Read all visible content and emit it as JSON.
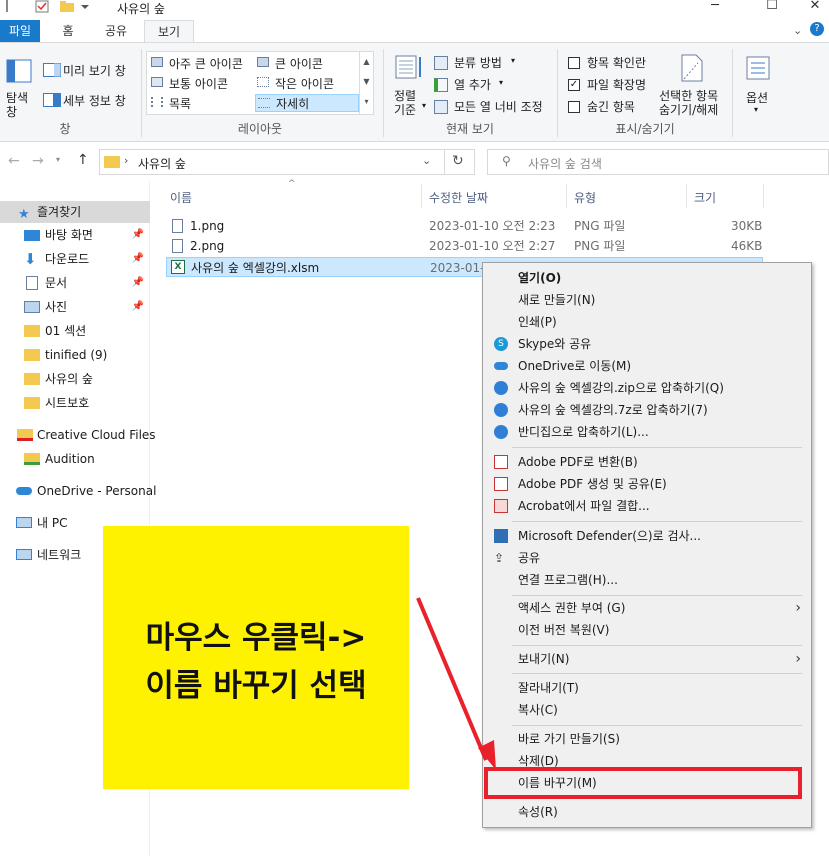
{
  "window": {
    "title": "사유의 숲",
    "minimize": "─",
    "maximize": "☐",
    "close": "✕"
  },
  "tabs": [
    "파일",
    "홈",
    "공유",
    "보기"
  ],
  "ribbon": {
    "pane": {
      "nav_pane": "탐색\n창",
      "preview": "미리 보기 창",
      "details": "세부 정보 창",
      "group": "창"
    },
    "layout": {
      "items": [
        "아주 큰 아이콘",
        "큰 아이콘",
        "보통 아이콘",
        "작은 아이콘",
        "목록",
        "자세히"
      ],
      "group": "레이아웃"
    },
    "current_view": {
      "sort": "정렬\n기준",
      "group_by": "분류 방법",
      "add_column": "열 추가",
      "fit_columns": "모든 열 너비 조정",
      "group": "현재 보기"
    },
    "show_hide": {
      "item_checkboxes": "항목 확인란",
      "file_extensions": "파일 확장명",
      "hidden_items": "숨긴 항목",
      "hide_selected": "선택한 항목\n숨기기/해제",
      "group": "표시/숨기기"
    },
    "options": "옵션"
  },
  "address": {
    "path": "사유의 숲",
    "search_placeholder": "사유의 숲 검색"
  },
  "nav": {
    "quick_access": "즐겨찾기",
    "items": [
      {
        "label": "바탕 화면",
        "pinned": true
      },
      {
        "label": "다운로드",
        "pinned": true
      },
      {
        "label": "문서",
        "pinned": true
      },
      {
        "label": "사진",
        "pinned": true
      },
      {
        "label": "01 섹션",
        "pinned": false
      },
      {
        "label": "tinified (9)",
        "pinned": false
      },
      {
        "label": "사유의 숲",
        "pinned": false
      },
      {
        "label": "시트보호",
        "pinned": false
      }
    ],
    "creative_cloud": "Creative Cloud Files",
    "audition": "Audition",
    "onedrive": "OneDrive - Personal",
    "this_pc": "내 PC",
    "network": "네트워크"
  },
  "files": {
    "columns": [
      "이름",
      "수정한 날짜",
      "유형",
      "크기"
    ],
    "rows": [
      {
        "name": "1.png",
        "date": "2023-01-10 오전 2:23",
        "type": "PNG 파일",
        "size": "30KB"
      },
      {
        "name": "2.png",
        "date": "2023-01-10 오전 2:27",
        "type": "PNG 파일",
        "size": "46KB"
      },
      {
        "name": "사유의 숲 엑셀강의.xlsm",
        "date": "2023-01-",
        "type": "",
        "size": ""
      }
    ]
  },
  "context_menu": {
    "items": [
      "열기(O)",
      "새로 만들기(N)",
      "인쇄(P)",
      "Skype와 공유",
      "OneDrive로 이동(M)",
      "사유의 숲 엑셀강의.zip으로 압축하기(Q)",
      "사유의 숲 엑셀강의.7z로 압축하기(7)",
      "반디집으로 압축하기(L)...",
      "Adobe PDF로 변환(B)",
      "Adobe PDF 생성 및 공유(E)",
      "Acrobat에서 파일 결합...",
      "Microsoft Defender(으)로 검사...",
      "공유",
      "연결 프로그램(H)...",
      "액세스 권한 부여 (G)",
      "이전 버전 복원(V)",
      "보내기(N)",
      "잘라내기(T)",
      "복사(C)",
      "바로 가기 만들기(S)",
      "삭제(D)",
      "이름 바꾸기(M)",
      "속성(R)"
    ],
    "submenu_arrow": "›"
  },
  "annotation": {
    "line1": "마우스 우클릭->",
    "line2": "이름 바꾸기 선택"
  },
  "colors": {
    "accent": "#1979ca",
    "highlight_yellow": "#fff200",
    "annotation_red": "#e8212a",
    "selected_row": "#cce8ff"
  }
}
